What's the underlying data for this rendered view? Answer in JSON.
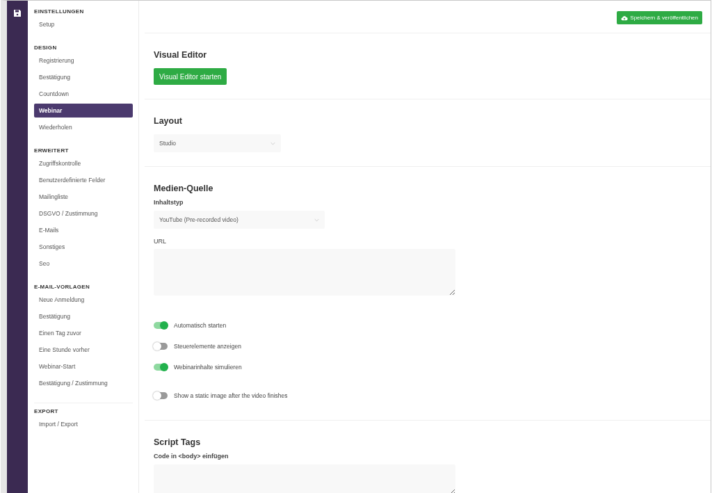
{
  "sidebar": {
    "sections": [
      {
        "heading": "EINSTELLUNGEN",
        "items": [
          {
            "label": "Setup",
            "selected": false
          }
        ]
      },
      {
        "heading": "DESIGN",
        "items": [
          {
            "label": "Registrierung",
            "selected": false
          },
          {
            "label": "Bestätigung",
            "selected": false
          },
          {
            "label": "Countdown",
            "selected": false
          },
          {
            "label": "Webinar",
            "selected": true
          },
          {
            "label": "Wiederholen",
            "selected": false
          }
        ]
      },
      {
        "heading": "ERWEITERT",
        "items": [
          {
            "label": "Zugriffskontrolle",
            "selected": false
          },
          {
            "label": "Benutzerdefinierte Felder",
            "selected": false
          },
          {
            "label": "Mailingliste",
            "selected": false
          },
          {
            "label": "DSGVO / Zustimmung",
            "selected": false
          },
          {
            "label": "E-Mails",
            "selected": false
          },
          {
            "label": "Sonstiges",
            "selected": false
          },
          {
            "label": "Seo",
            "selected": false
          }
        ]
      },
      {
        "heading": "E-MAIL-VORLAGEN",
        "items": [
          {
            "label": "Neue Anmeldung",
            "selected": false
          },
          {
            "label": "Bestätigung",
            "selected": false
          },
          {
            "label": "Einen Tag zuvor",
            "selected": false
          },
          {
            "label": "Eine Stunde vorher",
            "selected": false
          },
          {
            "label": "Webinar-Start",
            "selected": false
          },
          {
            "label": "Bestätigung / Zustimmung",
            "selected": false
          }
        ]
      },
      {
        "heading": "EXPORT",
        "items": [
          {
            "label": "Import / Export",
            "selected": false
          }
        ]
      }
    ]
  },
  "topbar": {
    "save_button": "Speichern & veröffentlichen"
  },
  "visual_editor": {
    "title": "Visual Editor",
    "button": "Visual Editor starten"
  },
  "layout": {
    "title": "Layout",
    "select": {
      "value": "Studio"
    }
  },
  "media_source": {
    "title": "Medien-Quelle",
    "content_type": {
      "label": "Inhaltstyp",
      "value": "YouTube (Pre-recorded video)"
    },
    "url": {
      "label": "URL"
    },
    "toggles": [
      {
        "label": "Automatisch starten",
        "on": true
      },
      {
        "label": "Steuerelemente anzeigen",
        "on": false
      },
      {
        "label": "Webinarinhalte simulieren",
        "on": true
      },
      {
        "label": "Show a static image after the video finishes",
        "on": false
      }
    ]
  },
  "script_tags": {
    "title": "Script Tags",
    "body_code": {
      "label": "Code in <body> einfügen"
    }
  }
}
